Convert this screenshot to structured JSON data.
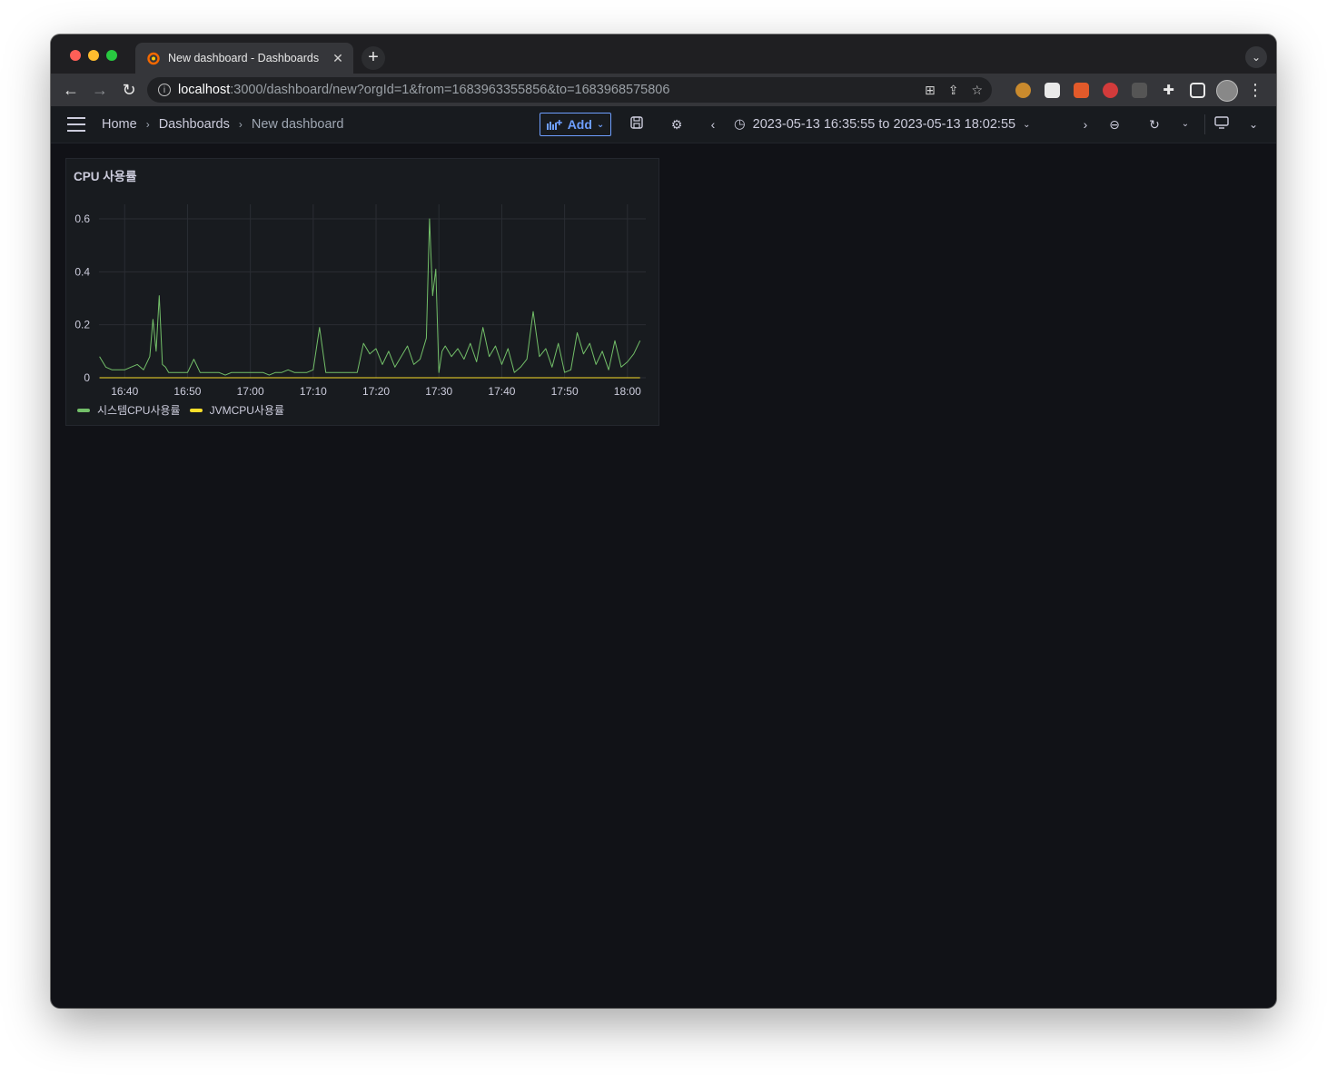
{
  "browser": {
    "tab_title": "New dashboard - Dashboards",
    "url_host": "localhost",
    "url_rest": ":3000/dashboard/new?orgId=1&from=1683963355856&to=1683968575806"
  },
  "nav": {
    "breadcrumbs": [
      "Home",
      "Dashboards",
      "New dashboard"
    ],
    "add_label": "Add",
    "time_range": "2023-05-13 16:35:55 to 2023-05-13 18:02:55"
  },
  "panel": {
    "title": "CPU 사용률"
  },
  "colors": {
    "series_system": "#73bf69",
    "series_jvm": "#fade2a",
    "accent": "#6e9fff"
  },
  "chart_data": {
    "type": "line",
    "title": "CPU 사용률",
    "x_ticks": [
      "16:40",
      "16:50",
      "17:00",
      "17:10",
      "17:20",
      "17:30",
      "17:40",
      "17:50",
      "18:00"
    ],
    "y_ticks": [
      "0",
      "0.2",
      "0.4",
      "0.6"
    ],
    "xlim": [
      "16:35:55",
      "18:02:55"
    ],
    "ylim": [
      0,
      0.6
    ],
    "grid": true,
    "legend_position": "bottom-left",
    "series": [
      {
        "name": "시스템CPU사용률",
        "color": "#73bf69",
        "x": [
          "16:36",
          "16:37",
          "16:38",
          "16:39",
          "16:40",
          "16:41",
          "16:42",
          "16:43",
          "16:44",
          "16:44:30",
          "16:45",
          "16:45:30",
          "16:46",
          "16:46:30",
          "16:47",
          "16:48",
          "16:49",
          "16:50",
          "16:51",
          "16:52",
          "16:53",
          "16:54",
          "16:55",
          "16:56",
          "16:57",
          "16:58",
          "16:59",
          "17:00",
          "17:01",
          "17:02",
          "17:03",
          "17:04",
          "17:05",
          "17:06",
          "17:07",
          "17:08",
          "17:09",
          "17:10",
          "17:11",
          "17:12",
          "17:13",
          "17:14",
          "17:15",
          "17:16",
          "17:17",
          "17:18",
          "17:19",
          "17:20",
          "17:21",
          "17:22",
          "17:23",
          "17:24",
          "17:25",
          "17:26",
          "17:27",
          "17:28",
          "17:28:30",
          "17:29",
          "17:29:30",
          "17:30",
          "17:30:30",
          "17:31",
          "17:32",
          "17:33",
          "17:34",
          "17:35",
          "17:36",
          "17:37",
          "17:38",
          "17:39",
          "17:40",
          "17:41",
          "17:42",
          "17:43",
          "17:44",
          "17:45",
          "17:46",
          "17:47",
          "17:48",
          "17:49",
          "17:50",
          "17:51",
          "17:52",
          "17:53",
          "17:54",
          "17:55",
          "17:56",
          "17:57",
          "17:58",
          "17:59",
          "18:00",
          "18:01",
          "18:02"
        ],
        "y": [
          0.08,
          0.04,
          0.03,
          0.03,
          0.03,
          0.04,
          0.05,
          0.03,
          0.08,
          0.22,
          0.1,
          0.31,
          0.05,
          0.04,
          0.02,
          0.02,
          0.02,
          0.02,
          0.07,
          0.02,
          0.02,
          0.02,
          0.02,
          0.01,
          0.02,
          0.02,
          0.02,
          0.02,
          0.02,
          0.02,
          0.01,
          0.02,
          0.02,
          0.03,
          0.02,
          0.02,
          0.02,
          0.03,
          0.19,
          0.02,
          0.02,
          0.02,
          0.02,
          0.02,
          0.02,
          0.13,
          0.09,
          0.11,
          0.05,
          0.1,
          0.04,
          0.08,
          0.12,
          0.05,
          0.07,
          0.15,
          0.6,
          0.31,
          0.41,
          0.02,
          0.1,
          0.12,
          0.08,
          0.11,
          0.07,
          0.13,
          0.06,
          0.19,
          0.08,
          0.12,
          0.05,
          0.11,
          0.02,
          0.04,
          0.07,
          0.25,
          0.08,
          0.11,
          0.04,
          0.13,
          0.02,
          0.03,
          0.17,
          0.09,
          0.13,
          0.05,
          0.1,
          0.03,
          0.14,
          0.04,
          0.06,
          0.09,
          0.14
        ]
      },
      {
        "name": "JVMCPU사용률",
        "color": "#fade2a",
        "x": [
          "16:36",
          "18:02"
        ],
        "y": [
          0.0,
          0.0
        ]
      }
    ]
  }
}
